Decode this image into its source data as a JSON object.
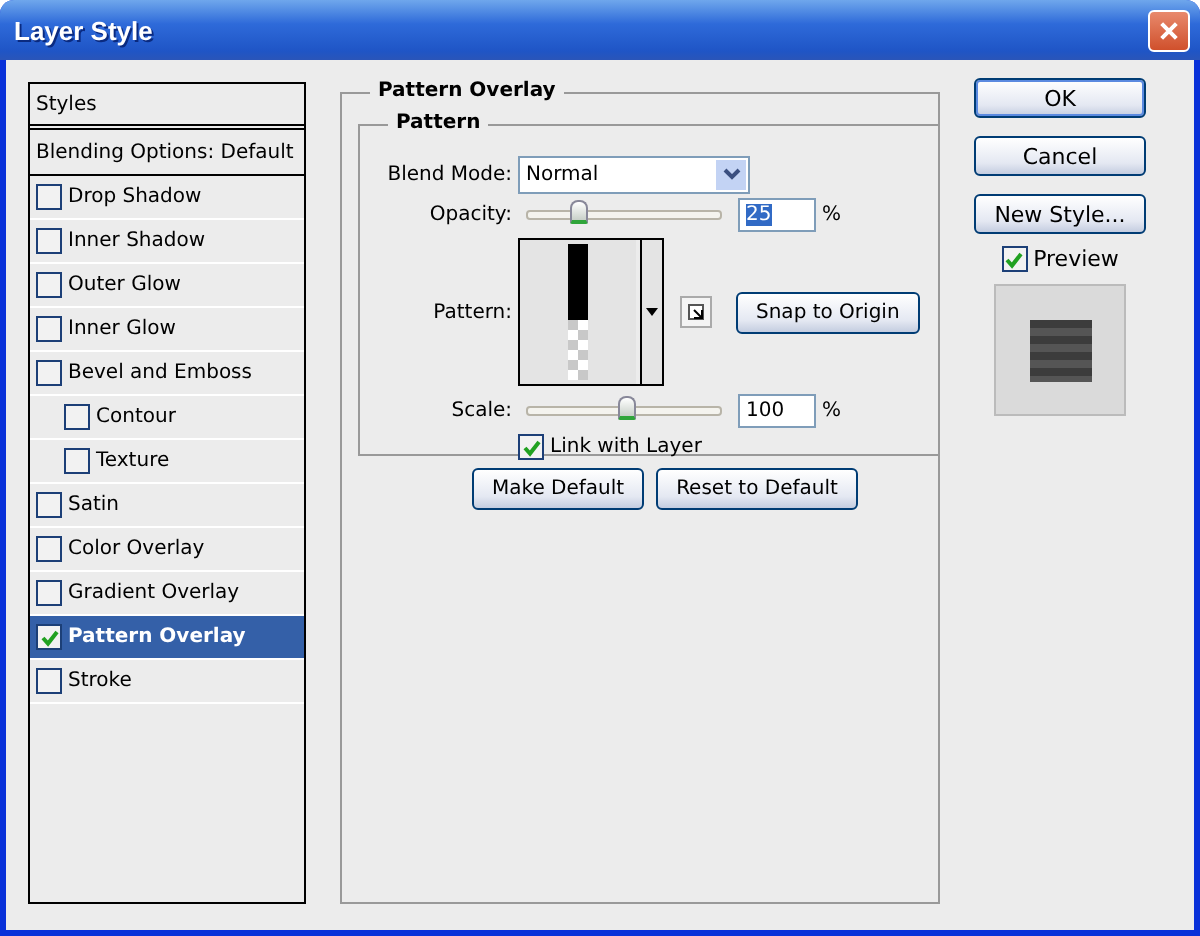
{
  "window": {
    "title": "Layer Style"
  },
  "styles_panel": {
    "items": [
      {
        "kind": "header",
        "label": "Styles",
        "selected": false
      },
      {
        "kind": "plain",
        "label": "Blending Options: Default",
        "selected": false
      },
      {
        "kind": "check",
        "label": "Drop Shadow",
        "checked": false,
        "selected": false
      },
      {
        "kind": "check",
        "label": "Inner Shadow",
        "checked": false,
        "selected": false
      },
      {
        "kind": "check",
        "label": "Outer Glow",
        "checked": false,
        "selected": false
      },
      {
        "kind": "check",
        "label": "Inner Glow",
        "checked": false,
        "selected": false
      },
      {
        "kind": "check",
        "label": "Bevel and Emboss",
        "checked": false,
        "selected": false,
        "children": [
          {
            "kind": "check",
            "label": "Contour",
            "checked": false,
            "selected": false
          },
          {
            "kind": "check",
            "label": "Texture",
            "checked": false,
            "selected": false
          }
        ]
      },
      {
        "kind": "check",
        "label": "Satin",
        "checked": false,
        "selected": false
      },
      {
        "kind": "check",
        "label": "Color Overlay",
        "checked": false,
        "selected": false
      },
      {
        "kind": "check",
        "label": "Gradient Overlay",
        "checked": false,
        "selected": false
      },
      {
        "kind": "check",
        "label": "Pattern Overlay",
        "checked": true,
        "selected": true
      },
      {
        "kind": "check",
        "label": "Stroke",
        "checked": false,
        "selected": false
      }
    ]
  },
  "pattern_overlay": {
    "title": "Pattern Overlay",
    "group_title": "Pattern",
    "blend_mode": {
      "label": "Blend Mode:",
      "value": "Normal"
    },
    "opacity": {
      "label": "Opacity:",
      "level": 0.26,
      "value": "25",
      "highlighted": true,
      "unit": "%"
    },
    "pattern": {
      "label": "Pattern:",
      "snap_button": "Snap to Origin"
    },
    "scale": {
      "label": "Scale:",
      "level": 0.51,
      "value": "100",
      "unit": "%"
    },
    "link_with_layer": {
      "label": "Link with Layer",
      "checked": true
    },
    "buttons": [
      "Make Default",
      "Reset to Default"
    ]
  },
  "actions": {
    "buttons": [
      {
        "label": "OK",
        "default": true
      },
      {
        "label": "Cancel",
        "default": false
      },
      {
        "label": "New Style...",
        "default": false
      }
    ],
    "preview": {
      "label": "Preview",
      "checked": true
    }
  }
}
